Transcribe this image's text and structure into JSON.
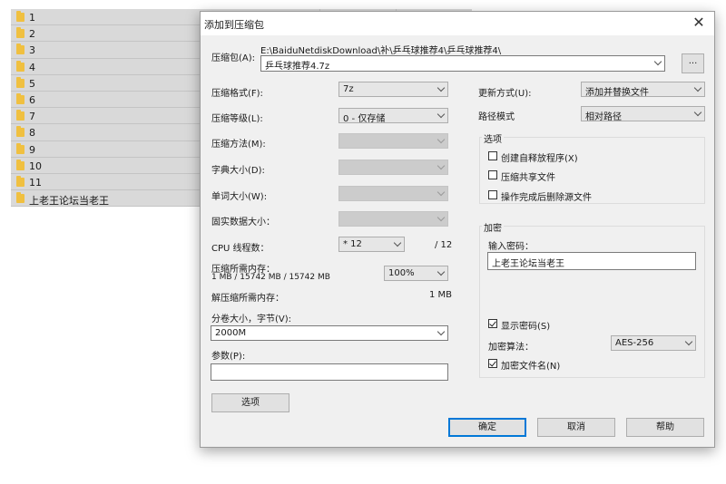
{
  "files": [
    "1",
    "2",
    "3",
    "4",
    "5",
    "6",
    "7",
    "8",
    "9",
    "10",
    "11",
    "上老王论坛当老王"
  ],
  "dialog": {
    "title": "添加到压缩包",
    "archive": {
      "label": "压缩包(A):",
      "path": "E:\\BaiduNetdiskDownload\\补\\乒乓球推荐4\\乒乓球推荐4\\",
      "name": "乒乓球推荐4.7z",
      "browse_label": "..."
    },
    "left": {
      "format": {
        "label": "压缩格式(F):",
        "value": "7z"
      },
      "level": {
        "label": "压缩等级(L):",
        "value": "0 - 仅存储"
      },
      "method": {
        "label": "压缩方法(M):",
        "value": ""
      },
      "dict": {
        "label": "字典大小(D):",
        "value": ""
      },
      "word": {
        "label": "单词大小(W):",
        "value": ""
      },
      "solid": {
        "label": "固实数据大小：",
        "value": ""
      },
      "cpu": {
        "label": "CPU 线程数：",
        "value": "* 12",
        "total": "/ 12"
      },
      "mem": {
        "label": "压缩所需内存：",
        "detail": "1 MB / 15742 MB / 15742 MB",
        "value": "100%"
      },
      "decomp": {
        "label": "解压缩所需内存：",
        "value": "1 MB"
      },
      "volume": {
        "label": "分卷大小，字节(V):",
        "value": "2000M"
      },
      "params": {
        "label": "参数(P):",
        "value": ""
      },
      "options_button": "选项"
    },
    "right": {
      "update": {
        "label": "更新方式(U):",
        "value": "添加并替换文件"
      },
      "pathmode": {
        "label": "路径模式",
        "value": "相对路径"
      },
      "options": {
        "title": "选项",
        "sfx": {
          "label": "创建自释放程序(X)",
          "checked": false
        },
        "shared": {
          "label": "压缩共享文件",
          "checked": false
        },
        "delete": {
          "label": "操作完成后删除源文件",
          "checked": false
        }
      },
      "encryption": {
        "title": "加密",
        "password_label": "输入密码：",
        "password": "上老王论坛当老王",
        "show_password": {
          "label": "显示密码(S)",
          "checked": true
        },
        "method_label": "加密算法：",
        "method": "AES-256",
        "encrypt_names": {
          "label": "加密文件名(N)",
          "checked": true
        }
      }
    },
    "buttons": {
      "ok": "确定",
      "cancel": "取消",
      "help": "帮助"
    }
  }
}
